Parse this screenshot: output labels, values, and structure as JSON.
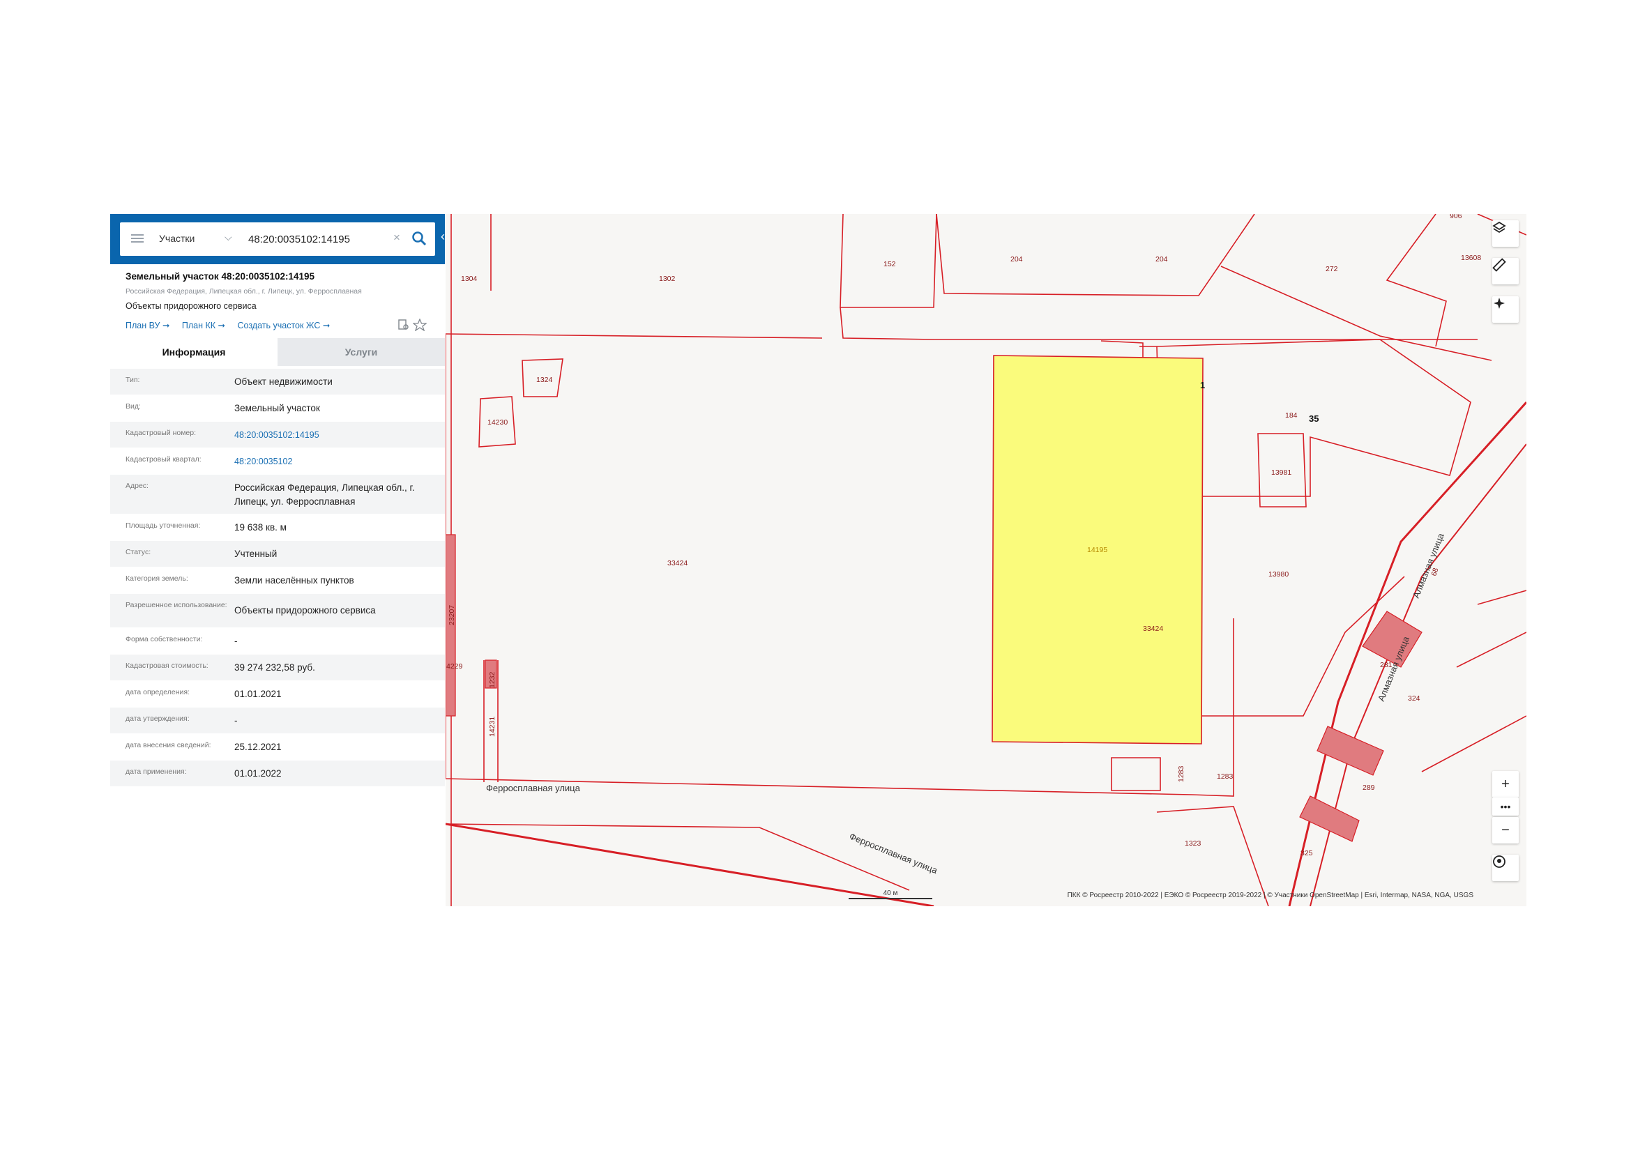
{
  "search": {
    "feature_type": "Участки",
    "query": "48:20:0035102:14195"
  },
  "card": {
    "title": "Земельный участок 48:20:0035102:14195",
    "address": "Российская Федерация, Липецкая обл., г. Липецк, ул. Ферросплавная",
    "use": "Объекты придорожного сервиса",
    "links": [
      "План ВУ ➞",
      "План КК ➞",
      "Создать участок ЖС ➞"
    ]
  },
  "tabs": {
    "info": "Информация",
    "services": "Услуги"
  },
  "properties": [
    {
      "label": "Тип:",
      "value": "Объект недвижимости"
    },
    {
      "label": "Вид:",
      "value": "Земельный участок"
    },
    {
      "label": "Кадастровый номер:",
      "value": "48:20:0035102:14195"
    },
    {
      "label": "Кадастровый квартал:",
      "value": "48:20:0035102"
    },
    {
      "label": "Адрес:",
      "value": "Российская Федерация, Липецкая обл., г. Липецк, ул. Ферросплавная"
    },
    {
      "label": "Площадь уточненная:",
      "value": "19 638 кв. м"
    },
    {
      "label": "Статус:",
      "value": "Учтенный"
    },
    {
      "label": "Категория земель:",
      "value": "Земли населённых пунктов"
    },
    {
      "label": "Разрешенное использование:",
      "value": "Объекты придорожного сервиса"
    },
    {
      "label": "Форма собственности:",
      "value": "-"
    },
    {
      "label": "Кадастровая стоимость:",
      "value": "39 274 232,58 руб."
    },
    {
      "label": "дата определения:",
      "value": "01.01.2021"
    },
    {
      "label": "дата утверждения:",
      "value": "-"
    },
    {
      "label": "дата внесения сведений:",
      "value": "25.12.2021"
    },
    {
      "label": "дата применения:",
      "value": "01.01.2022"
    }
  ],
  "map": {
    "parcel_labels": [
      "1304",
      "1302",
      "152",
      "204",
      "204",
      "272",
      "13608",
      "1324",
      "14230",
      "1",
      "184",
      "35",
      "13981",
      "13980",
      "33424",
      "14195",
      "33424",
      "23207",
      "4229",
      "1232",
      "14231",
      "1283",
      "1283",
      "1323",
      "281",
      "324",
      "289",
      "325",
      "68",
      "906"
    ],
    "roads": [
      "Ферросплавная улица",
      "Ферросплавная улица",
      "Алмазная улица",
      "Алмазная улица"
    ],
    "scale": "40 м",
    "attribution": "ПКК © Росреестр 2010-2022 | ЕЭКО © Росреестр 2019-2022 | © Участники OpenStreetMap | Esri, Intermap, NASA, NGA, USGS",
    "highlight_color": "#fafb7c",
    "border_color": "#d71f26"
  },
  "controls": [
    "layers-icon",
    "ruler-icon",
    "locate-icon",
    "zoom-in-icon",
    "more-icon",
    "zoom-out-icon",
    "geolocation-icon"
  ]
}
